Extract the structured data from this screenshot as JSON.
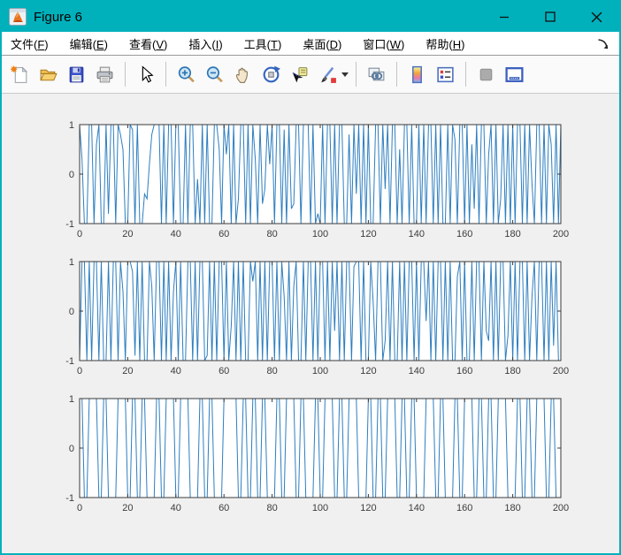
{
  "window": {
    "title": "Figure 6",
    "controls": {
      "minimize": "minimize",
      "maximize": "maximize",
      "close": "close"
    }
  },
  "colors": {
    "titlebar_teal": "#00B1BC",
    "figure_background": "#F0F0F0",
    "plot_background": "#FFFFFF",
    "axis_color": "#3A3A3A",
    "signal_blue": "#2E7EBF"
  },
  "menu": {
    "items": [
      {
        "pre": "文件(",
        "key": "F",
        "post": ")"
      },
      {
        "pre": "编辑(",
        "key": "E",
        "post": ")"
      },
      {
        "pre": "查看(",
        "key": "V",
        "post": ")"
      },
      {
        "pre": "插入(",
        "key": "I",
        "post": ")"
      },
      {
        "pre": "工具(",
        "key": "T",
        "post": ")"
      },
      {
        "pre": "桌面(",
        "key": "D",
        "post": ")"
      },
      {
        "pre": "窗口(",
        "key": "W",
        "post": ")"
      },
      {
        "pre": "帮助(",
        "key": "H",
        "post": ")"
      }
    ],
    "dock_arrow_icon": "dock-figure-arrow-icon"
  },
  "toolbar": {
    "buttons": [
      {
        "name": "new-figure",
        "icon": "new-document-icon",
        "enabled": true
      },
      {
        "name": "open-file",
        "icon": "open-folder-icon",
        "enabled": true
      },
      {
        "name": "save-figure",
        "icon": "save-floppy-icon",
        "enabled": true
      },
      {
        "name": "print-figure",
        "icon": "printer-icon",
        "enabled": true
      },
      {
        "name": "edit-plot",
        "icon": "pointer-arrow-icon",
        "enabled": true
      },
      {
        "name": "zoom-in",
        "icon": "zoom-in-icon",
        "enabled": true
      },
      {
        "name": "zoom-out",
        "icon": "zoom-out-icon",
        "enabled": true
      },
      {
        "name": "pan",
        "icon": "hand-icon",
        "enabled": true
      },
      {
        "name": "rotate-3d",
        "icon": "rotate-3d-icon",
        "enabled": true
      },
      {
        "name": "data-cursor",
        "icon": "data-cursor-icon",
        "enabled": true
      },
      {
        "name": "brush-data",
        "icon": "brush-icon",
        "enabled": true,
        "has_dropdown": true
      },
      {
        "name": "link-plot",
        "icon": "link-plot-icon",
        "enabled": true
      },
      {
        "name": "insert-colorbar",
        "icon": "colorbar-icon",
        "enabled": true
      },
      {
        "name": "insert-legend",
        "icon": "legend-icon",
        "enabled": true
      },
      {
        "name": "hide-plot-tools",
        "icon": "hide-plot-tools-icon",
        "enabled": false
      },
      {
        "name": "show-plot-tools",
        "icon": "show-plot-tools-icon",
        "enabled": true
      }
    ]
  },
  "chart_data": [
    {
      "type": "line",
      "title": "",
      "xlabel": "",
      "ylabel": "",
      "xlim": [
        0,
        200
      ],
      "ylim": [
        -1,
        1
      ],
      "grid": false,
      "legend": null,
      "xticks": [
        0,
        20,
        40,
        60,
        80,
        100,
        120,
        140,
        160,
        180,
        200
      ],
      "yticks": [
        -1,
        0,
        1
      ],
      "xtick_labels": [
        "0",
        "20",
        "40",
        "60",
        "80",
        "100",
        "120",
        "140",
        "160",
        "180",
        "200"
      ],
      "ytick_labels": [
        "-1",
        "0",
        "1"
      ],
      "line_color": "#2E7EBF",
      "x_start": 0,
      "x_step": 1,
      "values": [
        1,
        0.3,
        -1,
        -1,
        1,
        1,
        -1,
        0.6,
        1,
        -1,
        -1,
        1,
        -0.8,
        1,
        1,
        -1,
        1,
        0.8,
        0.5,
        -1,
        -1,
        1,
        0.9,
        -1,
        1,
        -1,
        -1,
        -0.4,
        -0.5,
        0.2,
        0.8,
        1,
        1,
        1,
        -1,
        1,
        -1,
        1,
        1,
        -1,
        1,
        1,
        -1,
        -1,
        1,
        -1,
        1,
        1,
        -1,
        -0.1,
        -1,
        1,
        -1,
        1,
        -1,
        -1,
        1,
        1,
        0.5,
        -1,
        1,
        0.4,
        1,
        -1,
        1,
        -1,
        -0.5,
        1,
        1,
        -1,
        1,
        -1,
        1,
        0.3,
        -1,
        1,
        -0.6,
        -0.3,
        1,
        0.2,
        1,
        -1,
        1,
        1,
        -1,
        0.9,
        -1,
        1,
        -0.7,
        -0.6,
        1,
        1,
        -1,
        1,
        1,
        1,
        -1,
        1,
        -1,
        -0.8,
        -1,
        1,
        -1,
        1,
        1,
        -1,
        1,
        -1,
        1,
        1,
        -1,
        -1,
        0.8,
        -1,
        1,
        -0.4,
        1,
        -1,
        1,
        -1,
        1,
        -1,
        -1,
        1,
        1,
        -1,
        1,
        -0.3,
        1,
        -1,
        1,
        1,
        -1,
        0.5,
        -1,
        1,
        1,
        -1,
        1,
        -1,
        -1,
        1,
        -1,
        1,
        -1,
        1,
        1,
        -1,
        1,
        -1,
        1,
        -1,
        -1,
        1,
        -1,
        1,
        0.7,
        -1,
        1,
        1,
        -1,
        1,
        -1,
        0.6,
        -0.7,
        1,
        -1,
        1,
        1,
        -1,
        0.4,
        1,
        -1,
        1,
        -1,
        -0.5,
        1,
        -1,
        1,
        -1,
        1,
        -1,
        1,
        1,
        -1,
        1,
        -1,
        1,
        -0.2,
        -1,
        1,
        1,
        -1,
        1,
        -1,
        1,
        0.6,
        -1,
        1,
        -1,
        1
      ]
    },
    {
      "type": "line",
      "title": "",
      "xlabel": "",
      "ylabel": "",
      "xlim": [
        0,
        200
      ],
      "ylim": [
        -1,
        1
      ],
      "grid": false,
      "legend": null,
      "xticks": [
        0,
        20,
        40,
        60,
        80,
        100,
        120,
        140,
        160,
        180,
        200
      ],
      "yticks": [
        -1,
        0,
        1
      ],
      "xtick_labels": [
        "0",
        "20",
        "40",
        "60",
        "80",
        "100",
        "120",
        "140",
        "160",
        "180",
        "200"
      ],
      "ytick_labels": [
        "-1",
        "0",
        "1"
      ],
      "line_color": "#2E7EBF",
      "x_start": 0,
      "x_step": 1,
      "values": [
        -1,
        1,
        1,
        -1,
        1,
        -1,
        1,
        1,
        -1,
        1,
        -1,
        -1,
        1,
        -1,
        1,
        1,
        -1,
        1,
        0.4,
        -1,
        1,
        1,
        0.8,
        -0.9,
        1,
        -1,
        1,
        -1,
        -1,
        1,
        0.5,
        -1,
        1,
        1,
        -1,
        1,
        -1,
        1,
        -1,
        0.4,
        1,
        -1,
        1,
        -1,
        -1,
        1,
        1,
        -1,
        1,
        -1,
        1,
        1,
        -1,
        -0.9,
        1,
        -1,
        1,
        -1,
        1,
        1,
        -1,
        1,
        -1,
        -0.3,
        1,
        -1,
        1,
        -1,
        1,
        -1,
        -1,
        1,
        0.6,
        1,
        -1,
        1,
        -1,
        1,
        -1,
        1,
        1,
        -1,
        1,
        -1,
        1,
        0.3,
        -1,
        1,
        -1,
        0.5,
        1,
        -1,
        -1,
        1,
        -1,
        1,
        1,
        -1,
        1,
        -1,
        1,
        1,
        -1,
        1,
        -1,
        1,
        -0.4,
        1,
        -1,
        1,
        -1,
        1,
        1,
        -1,
        0.9,
        1,
        1,
        -1,
        1,
        -1,
        -1,
        1,
        0.2,
        -1,
        1,
        1,
        -1,
        -0.6,
        1,
        -1,
        1,
        -1,
        -1,
        1,
        -1,
        1,
        -1,
        1,
        1,
        -1,
        1,
        -1,
        1,
        1,
        -0.2,
        1,
        -1,
        1,
        -1,
        1,
        1,
        -1,
        1,
        -1,
        1,
        -1,
        -1,
        0.7,
        1,
        -1,
        1,
        -1,
        -1,
        1,
        -1,
        1,
        1,
        -1,
        1,
        -0.4,
        -0.6,
        1,
        -1,
        1,
        -1,
        1,
        1,
        -1,
        -0.5,
        1,
        -1,
        1,
        -1,
        1,
        1,
        -1,
        1,
        -1,
        0.3,
        1,
        -1,
        1,
        1,
        -1,
        1,
        -1,
        1,
        -0.7,
        1,
        -1,
        -1
      ]
    },
    {
      "type": "line",
      "title": "",
      "xlabel": "",
      "ylabel": "",
      "xlim": [
        0,
        200
      ],
      "ylim": [
        -1,
        1
      ],
      "grid": false,
      "legend": null,
      "xticks": [
        0,
        20,
        40,
        60,
        80,
        100,
        120,
        140,
        160,
        180,
        200
      ],
      "yticks": [
        -1,
        0,
        1
      ],
      "xtick_labels": [
        "0",
        "20",
        "40",
        "60",
        "80",
        "100",
        "120",
        "140",
        "160",
        "180",
        "200"
      ],
      "ytick_labels": [
        "-1",
        "0",
        "1"
      ],
      "line_color": "#2E7EBF",
      "encoding": "bipolar-nrz",
      "bit_width": 2,
      "bits": [
        1,
        -1,
        1,
        1,
        -1,
        1,
        -1,
        -1,
        1,
        1,
        -1,
        1,
        -1,
        1,
        -1,
        -1,
        1,
        -1,
        1,
        1,
        -1,
        1,
        1,
        -1,
        -1,
        1,
        -1,
        1,
        -1,
        -1,
        1,
        1,
        1,
        -1,
        1,
        -1,
        1,
        -1,
        1,
        -1,
        -1,
        1,
        -1,
        1,
        1,
        -1,
        1,
        -1,
        -1,
        1,
        -1,
        1,
        1,
        -1,
        1,
        -1,
        1,
        1,
        -1,
        -1,
        1,
        -1,
        1,
        -1,
        1,
        1,
        -1,
        1,
        -1,
        1,
        -1,
        -1,
        1,
        1,
        -1,
        1,
        -1,
        -1,
        1,
        -1,
        1,
        1,
        -1,
        1,
        -1,
        1,
        -1,
        1,
        1,
        -1,
        -1,
        1,
        -1,
        1,
        -1,
        1,
        1,
        -1,
        1,
        -1
      ]
    }
  ]
}
